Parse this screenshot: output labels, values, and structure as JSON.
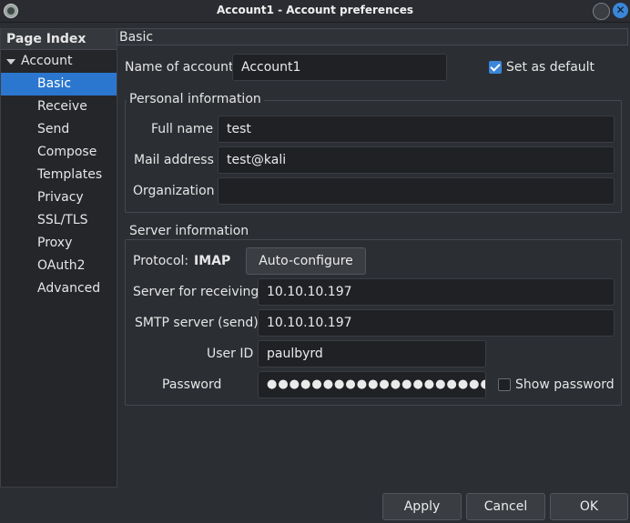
{
  "window": {
    "title": "Account1 - Account preferences",
    "close_glyph": "✕"
  },
  "sidebar": {
    "header": "Page Index",
    "parent": "Account",
    "items": [
      "Basic",
      "Receive",
      "Send",
      "Compose",
      "Templates",
      "Privacy",
      "SSL/TLS",
      "Proxy",
      "OAuth2",
      "Advanced"
    ],
    "selected": "Basic"
  },
  "section": {
    "title": "Basic"
  },
  "account": {
    "name_label": "Name of account",
    "name_value": "Account1",
    "default_label": "Set as default",
    "default_checked": true
  },
  "personal": {
    "title": "Personal information",
    "fullname_label": "Full name",
    "fullname_value": "test",
    "mail_label": "Mail address",
    "mail_value": "test@kali",
    "org_label": "Organization",
    "org_value": ""
  },
  "server": {
    "title": "Server information",
    "protocol_label": "Protocol:",
    "protocol_value": "IMAP",
    "autoconfig_label": "Auto-configure",
    "receiving_label": "Server for receiving",
    "receiving_value": "10.10.10.197",
    "smtp_label": "SMTP server (send)",
    "smtp_value": "10.10.10.197",
    "userid_label": "User ID",
    "userid_value": "paulbyrd",
    "password_label": "Password",
    "password_value": "●●●●●●●●●●●●●●●●●●●●●●●●●●●",
    "show_password_label": "Show password",
    "show_password_checked": false
  },
  "footer": {
    "apply": "Apply",
    "cancel": "Cancel",
    "ok": "OK"
  },
  "colors": {
    "accent": "#2b77cf",
    "background": "#2b2e33",
    "field": "#1f2125"
  }
}
